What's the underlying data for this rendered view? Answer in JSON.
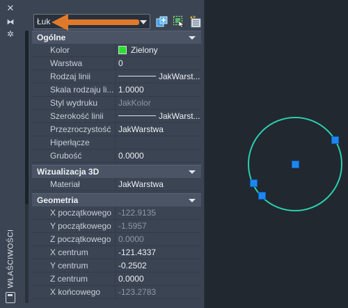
{
  "palette": {
    "vertical_title": "WŁAŚCIWOŚCI",
    "object_type": "Łuk",
    "arrow_color": "#e07a2b",
    "icons": {
      "close": "close-icon",
      "auto_hide": "auto-hide-icon",
      "settings": "settings-icon",
      "toggle_pickadd": "toggle-pickadd-icon",
      "select_objects": "select-objects-icon",
      "quick_select": "quick-select-icon",
      "properties": "properties-palette-icon"
    }
  },
  "sections": [
    {
      "title": "Ogólne",
      "rows": [
        {
          "label": "Kolor",
          "value": "Zielony",
          "swatch": "#27e12c"
        },
        {
          "label": "Warstwa",
          "value": "0"
        },
        {
          "label": "Rodzaj linii",
          "value": "JakWarst..."
        },
        {
          "label": "Skala rodzaju li...",
          "value": "1.0000"
        },
        {
          "label": "Styl wydruku",
          "value": "JakKolor"
        },
        {
          "label": "Szerokość linii",
          "value": "JakWarst..."
        },
        {
          "label": "Przezroczystość",
          "value": "JakWarstwa"
        },
        {
          "label": "Hiperłącze",
          "value": ""
        },
        {
          "label": "Grubość",
          "value": "0.0000"
        }
      ]
    },
    {
      "title": "Wizualizacja 3D",
      "rows": [
        {
          "label": "Materiał",
          "value": "JakWarstwa"
        }
      ]
    },
    {
      "title": "Geometria",
      "rows": [
        {
          "label": "X początkowego",
          "value": "-122.9135"
        },
        {
          "label": "Y początkowego",
          "value": "-1.5957"
        },
        {
          "label": "Z początkowego",
          "value": "0.0000"
        },
        {
          "label": "X centrum",
          "value": "-121.4337"
        },
        {
          "label": "Y centrum",
          "value": "-0.2502"
        },
        {
          "label": "Z centrum",
          "value": "0.0000"
        },
        {
          "label": "X końcowego",
          "value": "-123.2783"
        }
      ]
    }
  ],
  "drawing": {
    "arc_color": "#2ad0b0",
    "grip_color": "#1f86ef"
  }
}
